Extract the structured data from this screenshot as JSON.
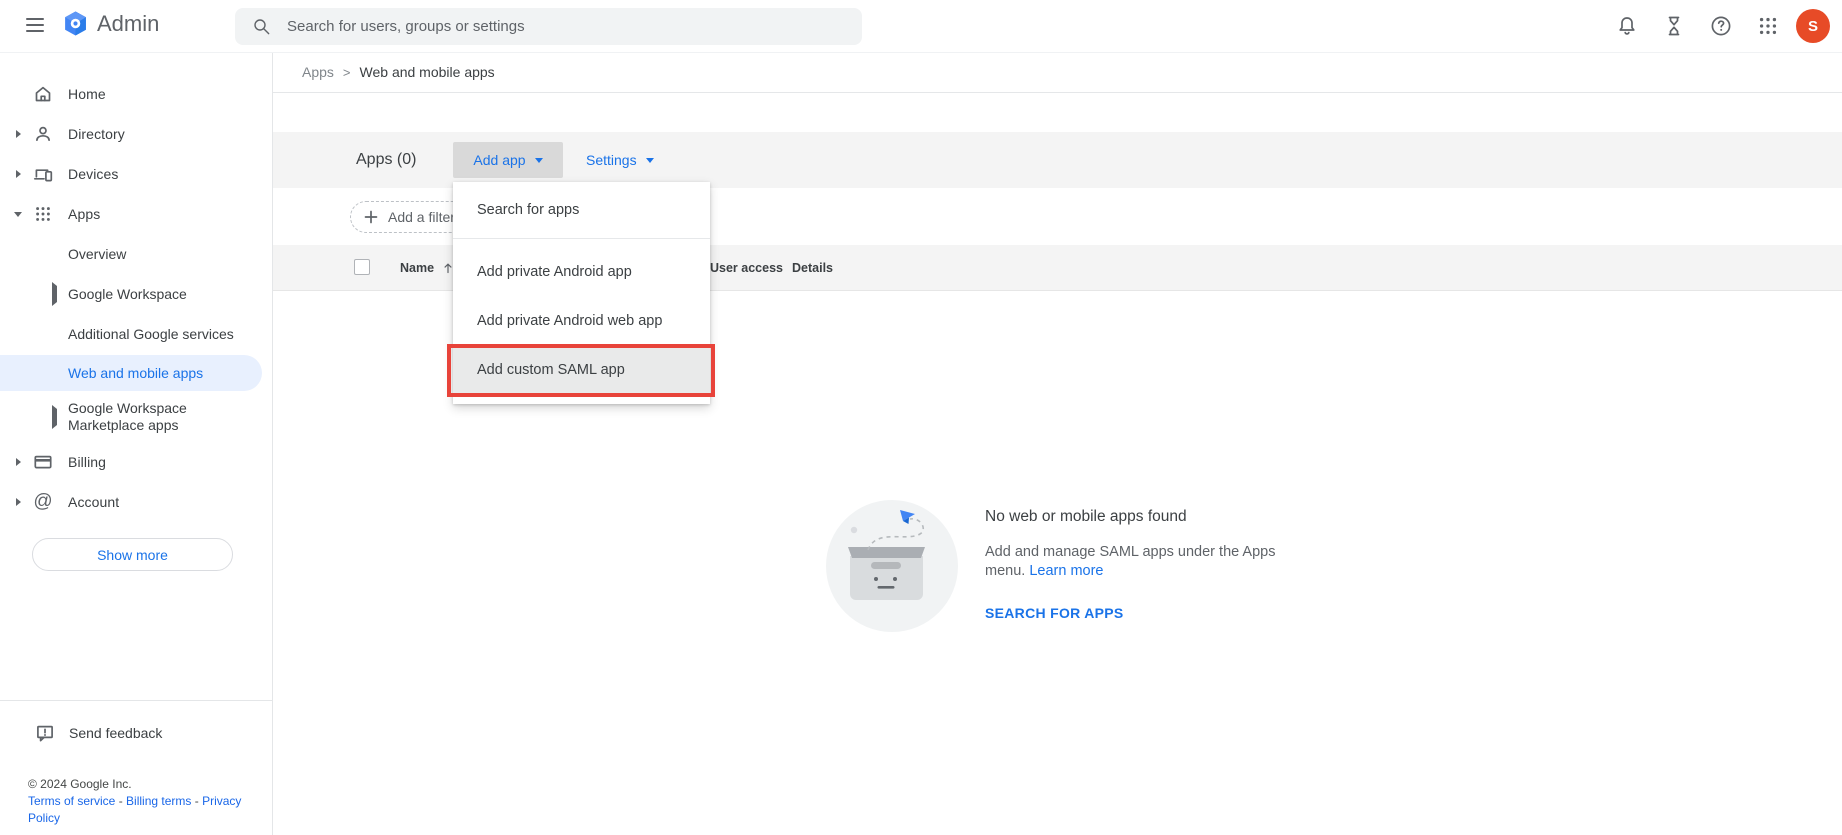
{
  "topbar": {
    "product_name": "Admin",
    "search_placeholder": "Search for users, groups or settings",
    "avatar_initial": "S",
    "icons": [
      "menu-icon",
      "search-icon",
      "notifications-bell-icon",
      "tasks-hourglass-icon",
      "help-icon",
      "google-apps-grid-icon",
      "avatar"
    ]
  },
  "breadcrumb": {
    "parent": "Apps",
    "separator": ">",
    "current": "Web and mobile apps"
  },
  "sidebar": {
    "items": [
      {
        "label": "Home"
      },
      {
        "label": "Directory"
      },
      {
        "label": "Devices"
      },
      {
        "label": "Apps"
      },
      {
        "label": "Billing"
      },
      {
        "label": "Account"
      }
    ],
    "apps_subitems": [
      {
        "label": "Overview"
      },
      {
        "label": "Google Workspace"
      },
      {
        "label": "Additional Google services"
      },
      {
        "label": "Web and mobile apps",
        "selected": true
      },
      {
        "label": "Google Workspace Marketplace apps"
      }
    ],
    "show_more_label": "Show more",
    "send_feedback_label": "Send feedback",
    "footer": {
      "copyright": "© 2024 Google Inc.",
      "links": [
        {
          "label": "Terms of service"
        },
        {
          "label": "Billing terms"
        },
        {
          "label": "Privacy Policy"
        }
      ],
      "link_separator": "-"
    }
  },
  "toolbar": {
    "title": "Apps (0)",
    "add_app_label": "Add app",
    "settings_label": "Settings"
  },
  "filter_bar": {
    "add_filter_label": "Add a filter"
  },
  "apps_table": {
    "columns": [
      {
        "label": "Name",
        "sorted": "ascending"
      },
      {
        "label": "User access"
      },
      {
        "label": "Details"
      }
    ]
  },
  "add_app_menu": {
    "items": [
      {
        "label": "Search for apps"
      },
      {
        "label": "Add private Android app"
      },
      {
        "label": "Add private Android web app"
      },
      {
        "label": "Add custom SAML app",
        "highlighted": true
      }
    ]
  },
  "empty_state": {
    "title": "No web or mobile apps found",
    "description": "Add and manage SAML apps under the Apps menu.",
    "learn_more_label": "Learn more",
    "cta_label": "SEARCH FOR APPS"
  },
  "colors": {
    "accent_blue": "#1a73e8",
    "annotation_red": "#e8433a",
    "avatar_orange": "#e74b27",
    "selected_item_bg": "#e8f0fe"
  }
}
